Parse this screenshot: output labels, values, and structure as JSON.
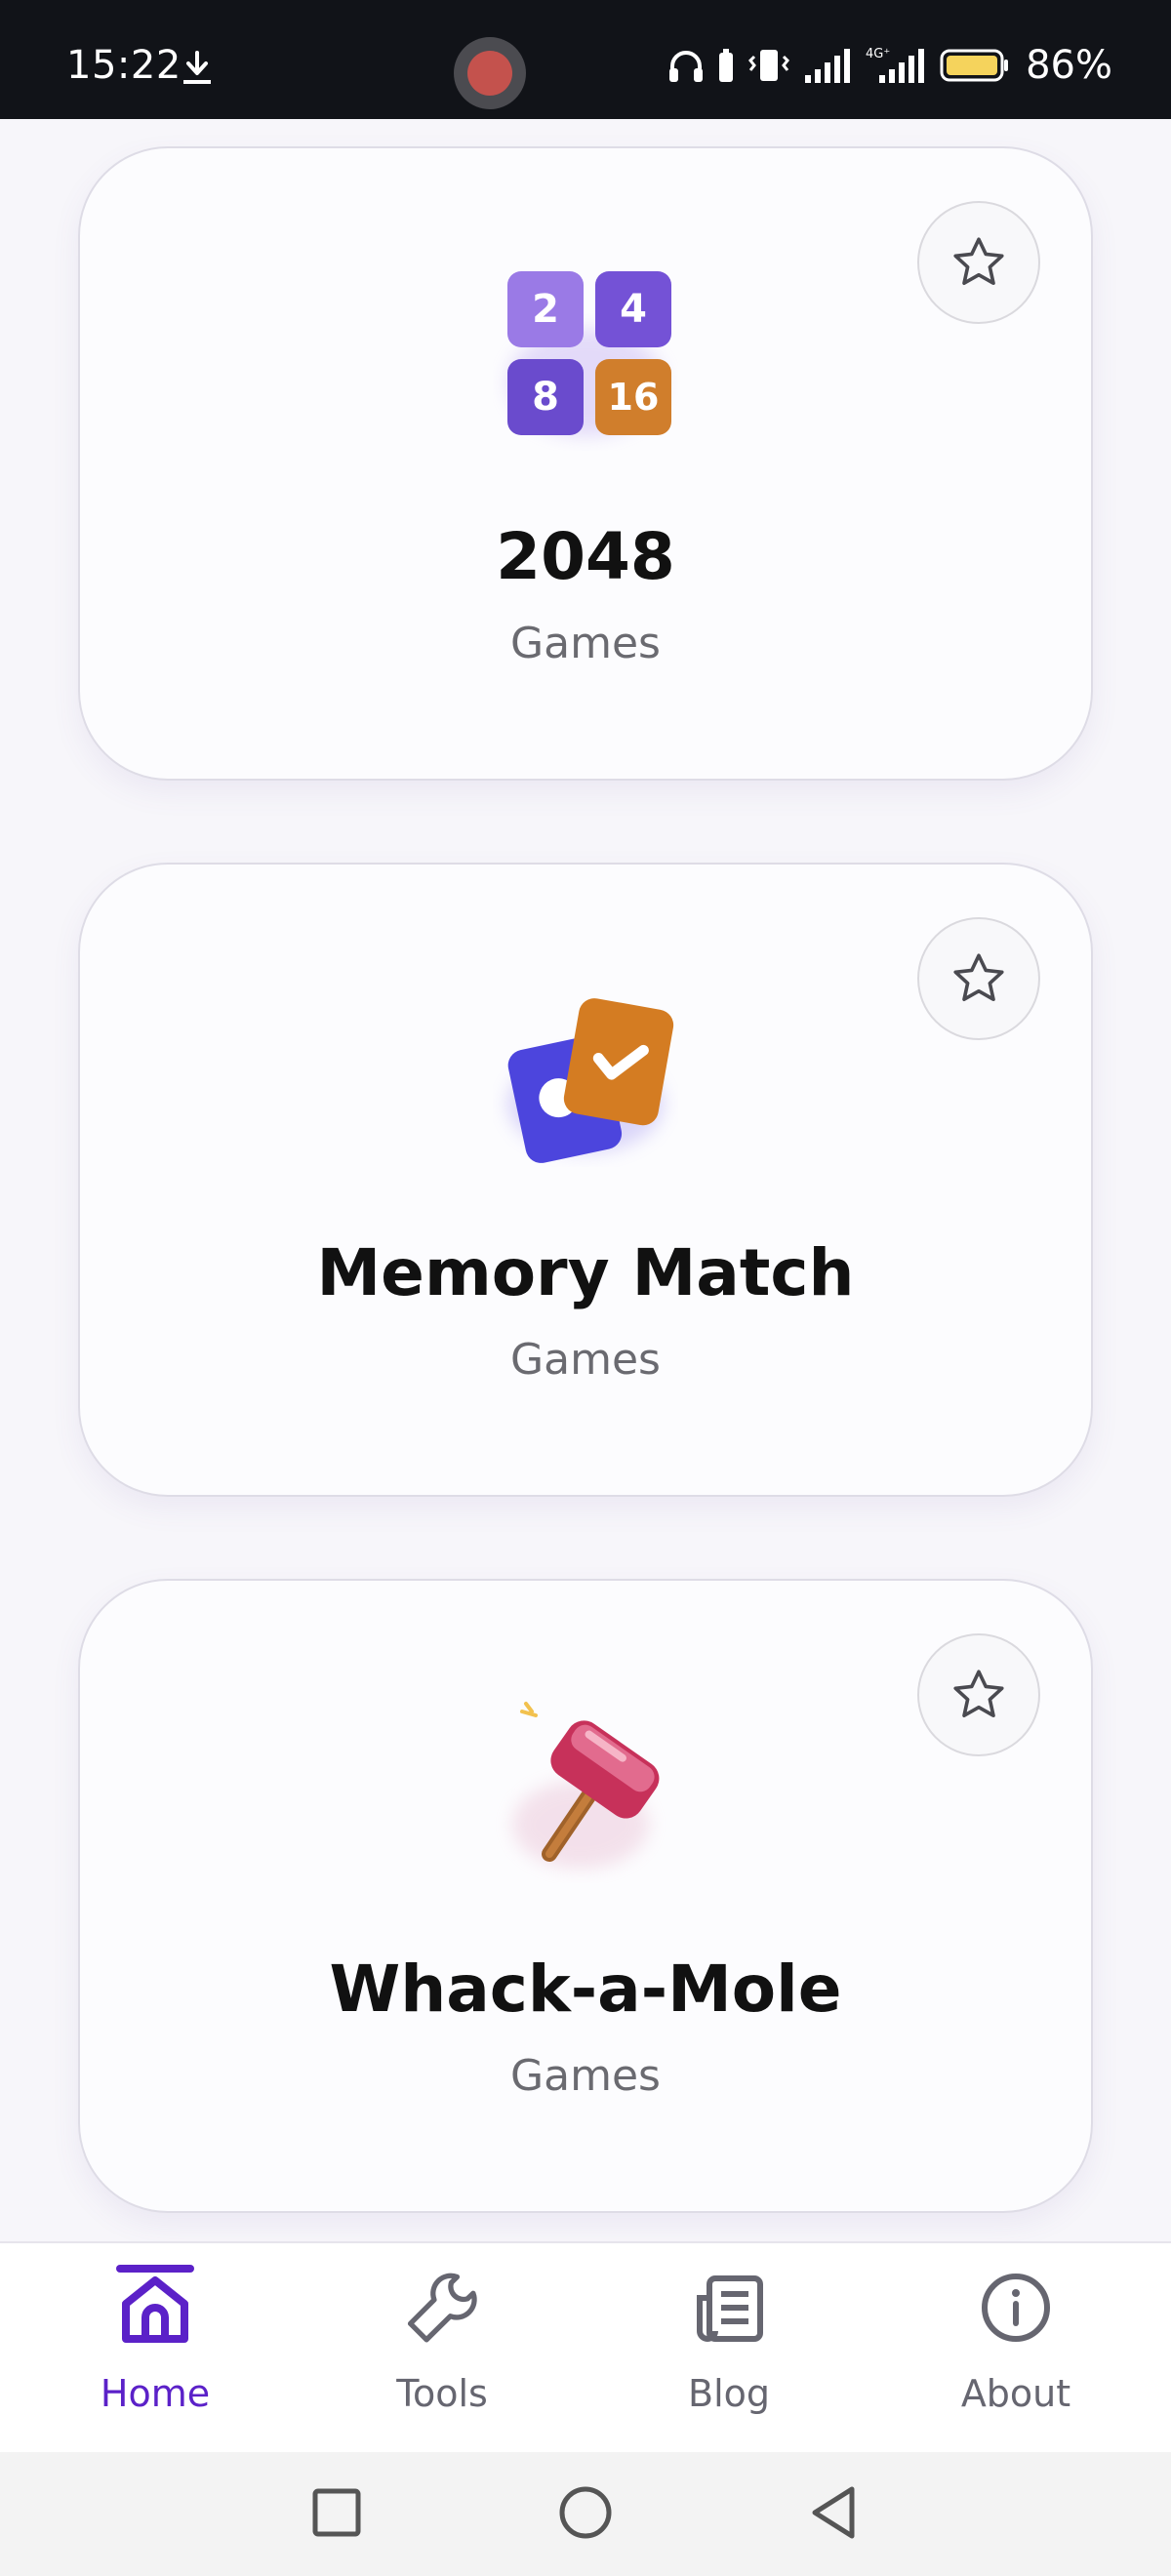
{
  "status_bar": {
    "time": "15:22",
    "battery_percent": "86%",
    "network_label": "4G⁺",
    "icons": [
      "download-icon",
      "screen-record-icon",
      "headphones-icon",
      "vibrate-icon",
      "signal-icon",
      "battery-icon"
    ]
  },
  "cards": [
    {
      "title": "2048",
      "category": "Games",
      "icon": "tiles-2048-icon",
      "tiles": [
        "2",
        "4",
        "8",
        "16"
      ],
      "favorited": false
    },
    {
      "title": "Memory Match",
      "category": "Games",
      "icon": "memory-cards-icon",
      "favorited": false
    },
    {
      "title": "Whack-a-Mole",
      "category": "Games",
      "icon": "hammer-icon",
      "favorited": false
    }
  ],
  "bottom_nav": {
    "items": [
      {
        "label": "Home",
        "icon": "home-icon",
        "active": true
      },
      {
        "label": "Tools",
        "icon": "wrench-icon",
        "active": false
      },
      {
        "label": "Blog",
        "icon": "newspaper-icon",
        "active": false
      },
      {
        "label": "About",
        "icon": "info-icon",
        "active": false
      }
    ],
    "active_color": "#5b21c8",
    "inactive_color": "#666670"
  },
  "system_nav": {
    "buttons": [
      "recents-button",
      "home-button",
      "back-button"
    ]
  },
  "colors": {
    "tile_purple_light": "#9a7ae6",
    "tile_purple": "#7452d6",
    "tile_orange": "#d07e2c",
    "card_blue": "#4c45dd",
    "hammer_pink": "#d2436a"
  }
}
